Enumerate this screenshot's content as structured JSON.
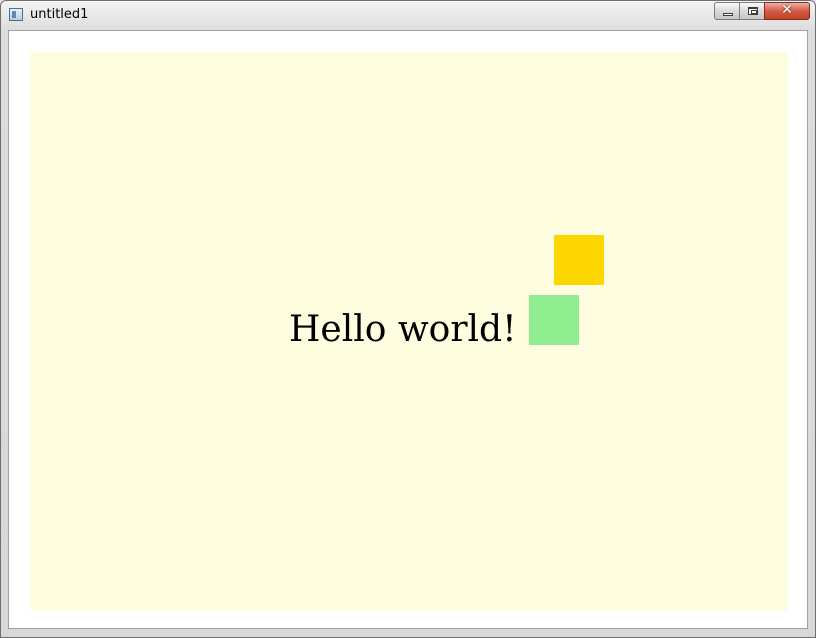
{
  "window": {
    "title": "untitled1",
    "app_icon": "application-window-icon",
    "controls": {
      "minimize_icon": "minimize-icon",
      "maximize_icon": "maximize-icon",
      "close_glyph": "✕"
    }
  },
  "canvas": {
    "background_color": "#fffde0",
    "text": "Hello world!",
    "squares": [
      {
        "name": "gold",
        "color": "#ffd700"
      },
      {
        "name": "green",
        "color": "#90ee90"
      }
    ]
  }
}
